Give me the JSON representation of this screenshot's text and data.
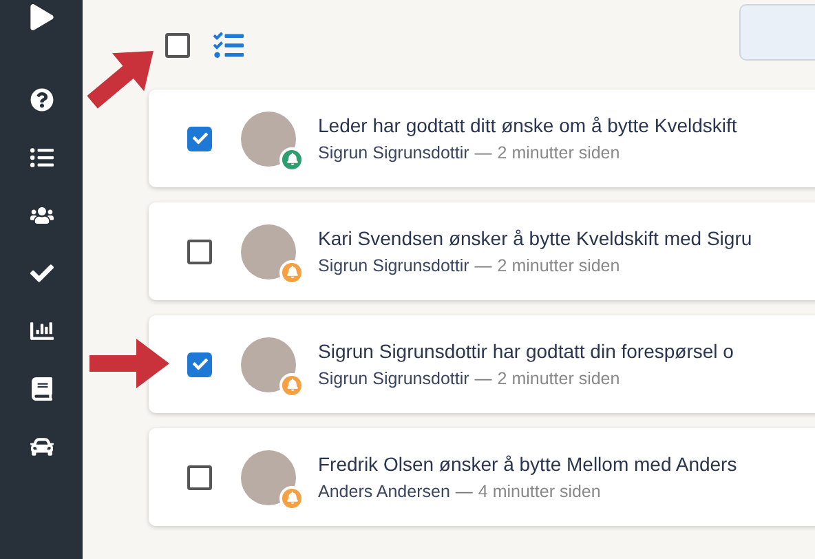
{
  "header": {
    "select_all": {
      "checked": false
    }
  },
  "notifications": [
    {
      "title": "Leder har godtatt ditt ønske om å bytte Kveldskift",
      "author": "Sigrun Sigrunsdottir",
      "separator": "—",
      "time": "2 minutter siden",
      "checked": true,
      "color": "#2e9e6e"
    },
    {
      "title": "Kari Svendsen ønsker å bytte Kveldskift med Sigru",
      "author": "Sigrun Sigrunsdottir",
      "separator": "—",
      "time": "2 minutter siden",
      "checked": false,
      "color": "#f5a042"
    },
    {
      "title": "Sigrun Sigrunsdottir har godtatt din forespørsel o",
      "author": "Sigrun Sigrunsdottir",
      "separator": "—",
      "time": "2 minutter siden",
      "checked": true,
      "color": "#f5a042"
    },
    {
      "title": "Fredrik Olsen ønsker å bytte Mellom med Anders",
      "author": "Anders Andersen",
      "separator": "—",
      "time": "4 minutter siden",
      "checked": false,
      "color": "#f5a042"
    }
  ]
}
